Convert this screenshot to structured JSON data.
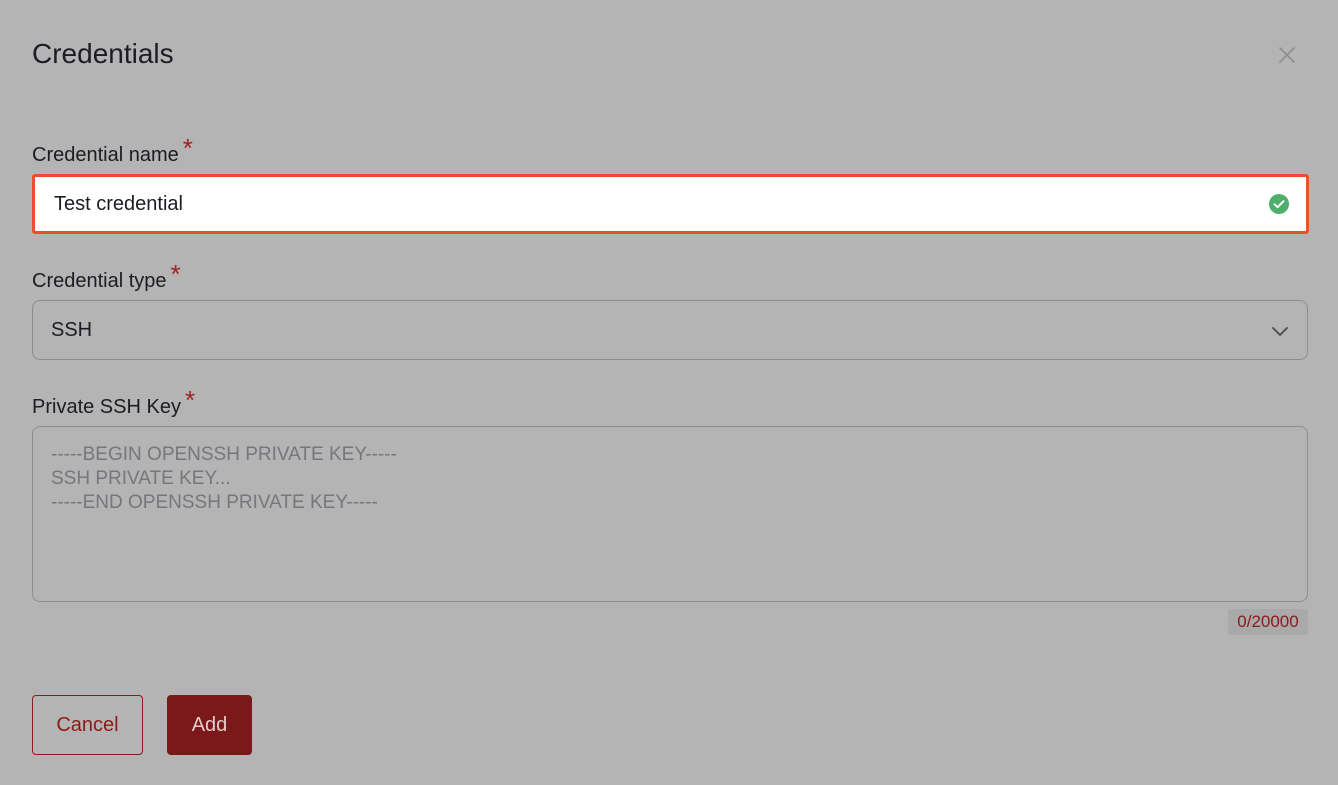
{
  "dialog": {
    "title": "Credentials",
    "close_icon": "close-icon"
  },
  "credential_name": {
    "label": "Credential name",
    "required_mark": "*",
    "value": "Test credential",
    "status_icon": "check-circle-icon",
    "border_color": "#e8502f",
    "status_color": "#4caf6a"
  },
  "credential_type": {
    "label": "Credential type",
    "required_mark": "*",
    "selected": "SSH",
    "chevron_icon": "chevron-down-icon"
  },
  "private_key": {
    "label": "Private SSH Key",
    "required_mark": "*",
    "value": "",
    "placeholder": "-----BEGIN OPENSSH PRIVATE KEY-----\nSSH PRIVATE KEY...\n-----END OPENSSH PRIVATE KEY-----",
    "counter": "0/20000"
  },
  "actions": {
    "cancel_label": "Cancel",
    "add_label": "Add"
  },
  "colors": {
    "overlay_bg": "#b4b4b4",
    "accent": "#7b1819",
    "required": "#a12222"
  }
}
